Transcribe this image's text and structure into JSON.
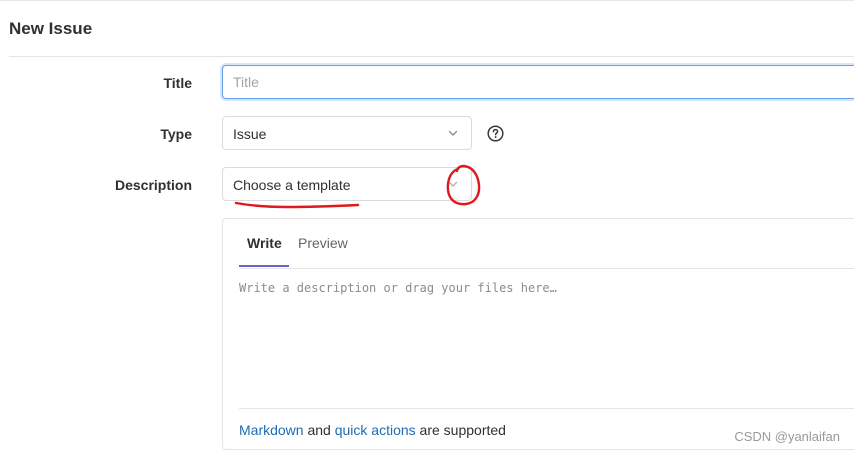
{
  "header": {
    "title": "New Issue"
  },
  "form": {
    "title_label": "Title",
    "title_placeholder": "Title",
    "title_value": "",
    "type_label": "Type",
    "type_value": "Issue",
    "description_label": "Description",
    "template_value": "Choose a template"
  },
  "editor": {
    "tabs": [
      {
        "label": "Write",
        "active": true
      },
      {
        "label": "Preview",
        "active": false
      }
    ],
    "placeholder": "Write a description or drag your files here…",
    "footer": {
      "link1": "Markdown",
      "mid": " and ",
      "link2": "quick actions",
      "suffix": " are supported"
    }
  },
  "icons": {
    "help": "question-circle-icon",
    "chevron": "chevron-down-icon"
  },
  "colors": {
    "focus_border": "#6aa0e8",
    "link": "#1f6bb5",
    "active_tab": "#6666c4",
    "annotation": "#e0191d"
  },
  "watermark": "CSDN @yanlaifan"
}
